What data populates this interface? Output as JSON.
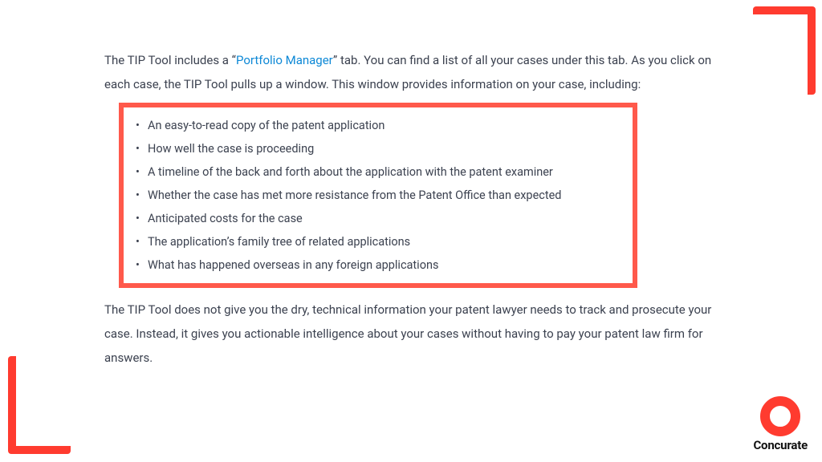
{
  "intro": {
    "pre": "The TIP Tool includes a “",
    "link": "Portfolio Manager",
    "post": "” tab. You can find a list of all your cases under this tab. As you click on each case, the TIP Tool pulls up a window. This window provides information on your case, including:"
  },
  "bullets": [
    "An easy-to-read copy of the patent application",
    "How well the case is proceeding",
    "A timeline of the back and forth about the application with the patent examiner",
    "Whether the case has met more resistance from the Patent Office than expected",
    "Anticipated costs for the case",
    "The application’s family tree of related applications",
    "What has happened overseas in any foreign applications"
  ],
  "outro": "The TIP Tool does not give you the dry, technical information your patent lawyer needs to track and prosecute your case. Instead, it gives you actionable intelligence about your cases without having to pay your patent law firm for answers.",
  "brand": "Concurate"
}
